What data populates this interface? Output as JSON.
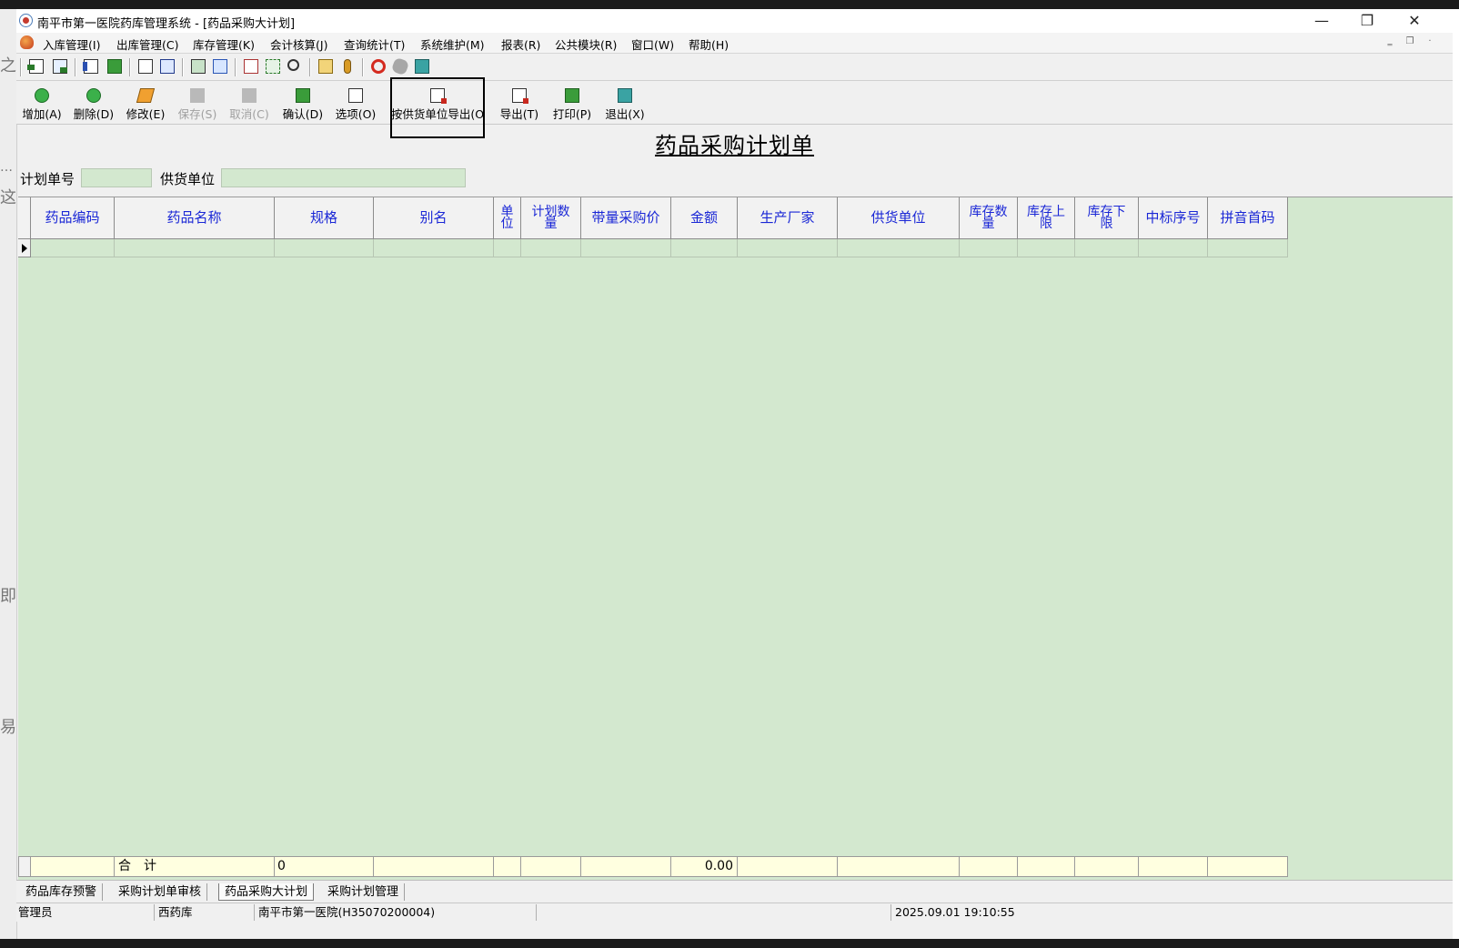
{
  "window": {
    "title": "南平市第一医院药库管理系统 - [药品采购大计划]",
    "minimize": "—",
    "restore": "❐",
    "close": "✕"
  },
  "left_fragments": [
    "之",
    "…",
    "这",
    "即",
    "易"
  ],
  "menu": [
    "入库管理(I)",
    "出库管理(C)",
    "库存管理(K)",
    "会计核算(J)",
    "查询统计(T)",
    "系统维护(M)",
    "报表(R)",
    "公共模块(R)",
    "窗口(W)",
    "帮助(H)"
  ],
  "toolbar_buttons": [
    {
      "label": "增加(A)",
      "icon": "add-icon",
      "enabled": true
    },
    {
      "label": "删除(D)",
      "icon": "delete-icon",
      "enabled": true
    },
    {
      "label": "修改(E)",
      "icon": "edit-icon",
      "enabled": true
    },
    {
      "label": "保存(S)",
      "icon": "save-icon",
      "enabled": false
    },
    {
      "label": "取消(C)",
      "icon": "cancel-icon",
      "enabled": false
    },
    {
      "label": "确认(D)",
      "icon": "confirm-icon",
      "enabled": true
    },
    {
      "label": "选项(O)",
      "icon": "options-icon",
      "enabled": true
    },
    {
      "label": "按供货单位导出(O",
      "icon": "export-by-supplier-icon",
      "enabled": true
    },
    {
      "label": "导出(T)",
      "icon": "export-icon",
      "enabled": true
    },
    {
      "label": "打印(P)",
      "icon": "print-icon",
      "enabled": true
    },
    {
      "label": "退出(X)",
      "icon": "exit-icon",
      "enabled": true
    }
  ],
  "form": {
    "title": "药品采购计划单",
    "plan_no_label": "计划单号",
    "plan_no_value": "",
    "supplier_label": "供货单位",
    "supplier_value": ""
  },
  "grid": {
    "columns": [
      "药品编码",
      "药品名称",
      "规格",
      "别名",
      "单位",
      "计划数量",
      "带量采购价",
      "金额",
      "生产厂家",
      "供货单位",
      "库存数量",
      "库存上限",
      "库存下限",
      "中标序号",
      "拼音首码"
    ],
    "rows": [
      [
        "",
        "",
        "",
        "",
        "",
        "",
        "",
        "",
        "",
        "",
        "",
        "",
        "",
        "",
        ""
      ]
    ],
    "total": {
      "label": "合　计",
      "quantity": "0",
      "amount": "0.00"
    }
  },
  "tabs": [
    "药品库存预警",
    "采购计划单审核",
    "药品采购大计划",
    "采购计划管理"
  ],
  "active_tab": 2,
  "status": {
    "user": "管理员",
    "store": "西药库",
    "hospital": "南平市第一医院(H35070200004)",
    "extra": "",
    "datetime": "2025.09.01 19:10:55"
  },
  "colors": {
    "grid_bg": "#d3e8cf",
    "header_text": "#1a27d6",
    "total_bg": "#ffffe0"
  }
}
